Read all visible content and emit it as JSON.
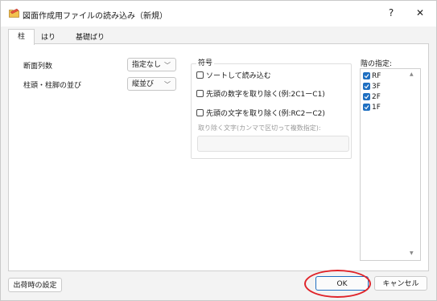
{
  "window": {
    "title": "図面作成用ファイルの読み込み（新規）",
    "help_label": "?",
    "close_label": "✕"
  },
  "tabs": [
    {
      "label": "柱",
      "active": true
    },
    {
      "label": "はり",
      "active": false
    },
    {
      "label": "基礎ばり",
      "active": false
    }
  ],
  "column_settings": {
    "section_count_label": "断面列数",
    "section_count_value": "指定なし",
    "order_label": "柱頭・柱脚の並び",
    "order_value": "縦並び"
  },
  "symbol_group": {
    "title": "符号",
    "options": [
      {
        "label": "ソートして読み込む",
        "checked": false
      },
      {
        "label": "先頭の数字を取り除く(例:2C1ーC1)",
        "checked": false
      },
      {
        "label": "先頭の文字を取り除く(例:RC2ーC2)",
        "checked": false
      }
    ],
    "remove_chars_label": "取り除く文字(カンマで区切って複数指定):",
    "remove_chars_value": ""
  },
  "floors": {
    "label": "階の指定:",
    "items": [
      {
        "label": "RF",
        "checked": true
      },
      {
        "label": "3F",
        "checked": true
      },
      {
        "label": "2F",
        "checked": true
      },
      {
        "label": "1F",
        "checked": true
      }
    ]
  },
  "footer": {
    "output_settings_label": "出荷時の設定",
    "ok_label": "OK",
    "cancel_label": "キャンセル"
  },
  "colors": {
    "accent": "#1f6fc1",
    "highlight": "#e0242a"
  }
}
